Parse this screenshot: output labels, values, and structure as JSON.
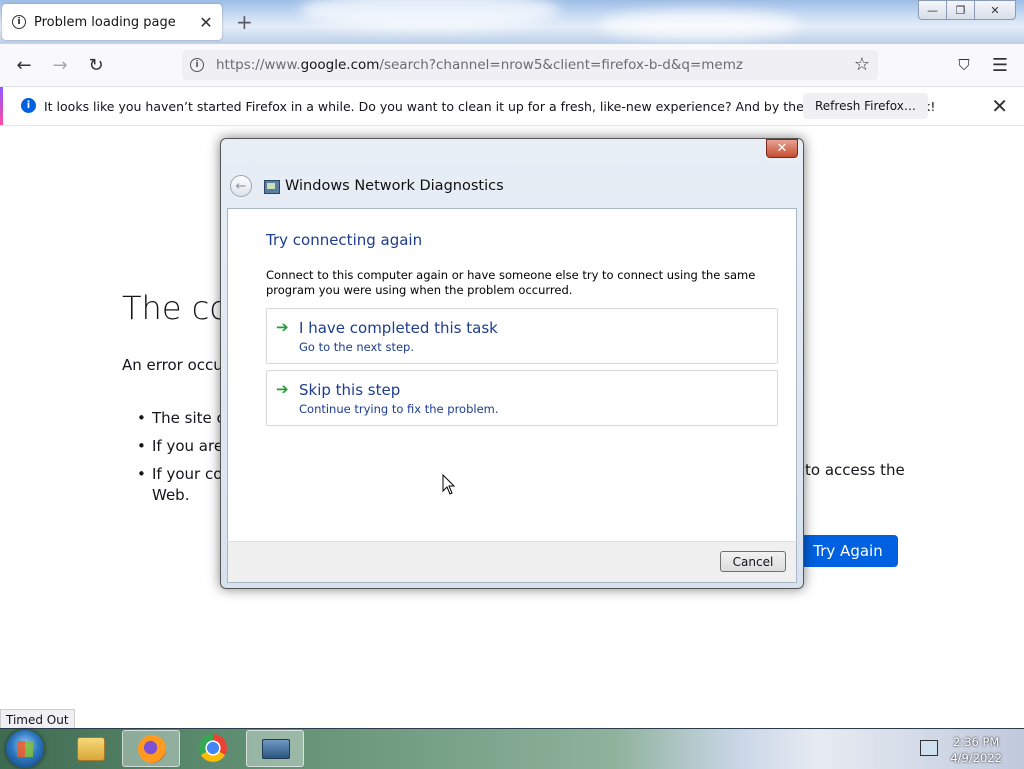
{
  "browser": {
    "tab_title": "Problem loading page",
    "tab_close": "✕",
    "new_tab": "+",
    "url_prefix": "https://www.",
    "url_domain": "google.com",
    "url_rest": "/search?channel=nrow5&client=firefox-b-d&q=memz",
    "window_controls": {
      "minimize": "—",
      "restore": "❐",
      "close": "✕"
    },
    "nav": {
      "back": "←",
      "forward": "→",
      "reload": "↻",
      "star": "☆",
      "pocket": "⛉",
      "menu": "☰"
    }
  },
  "notification": {
    "message": "It looks like you haven’t started Firefox in a while. Do you want to clean it up for a fresh, like-new experience? And by the way, welcome back!",
    "button": "Refresh Firefox…",
    "close": "✕"
  },
  "error_page": {
    "title": "The co",
    "description": "An error occurr",
    "bullets": [
      "The site co",
      "If you are c",
      "If your con"
    ],
    "bullet3_cont": "Web.",
    "bullet3_end": "to access the",
    "try_again": "Try Again",
    "status": "Timed Out"
  },
  "dialog": {
    "title": "Windows Network Diagnostics",
    "close": "✕",
    "heading": "Try connecting again",
    "body": "Connect to this computer again or have someone else try to connect using the same program you were using when the problem occurred.",
    "options": [
      {
        "title": "I have completed this task",
        "subtitle": "Go to the next step."
      },
      {
        "title": "Skip this step",
        "subtitle": "Continue trying to fix the problem."
      }
    ],
    "cancel": "Cancel"
  },
  "taskbar": {
    "time": "2:36 PM",
    "date": "4/9/2022"
  }
}
